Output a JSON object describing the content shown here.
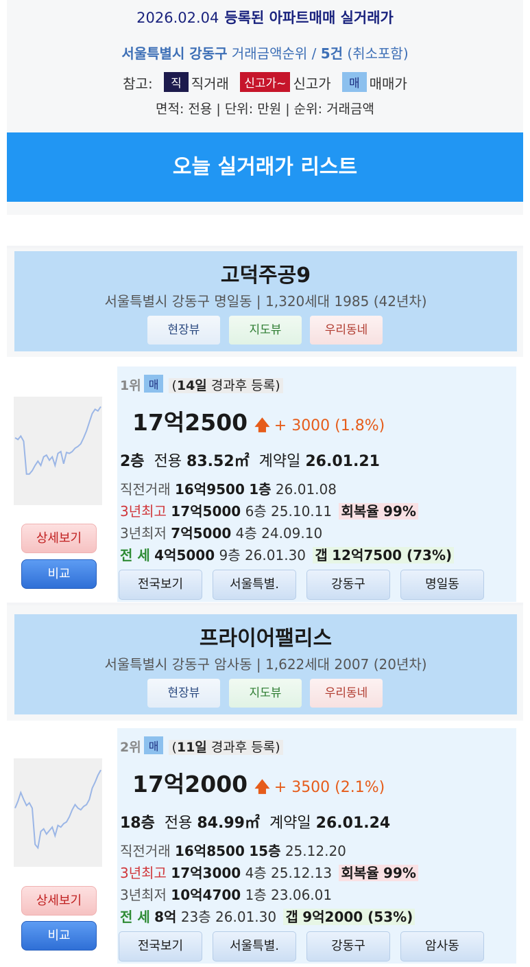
{
  "header": {
    "date": "2026.02.04",
    "title": "등록된 아파트매매 실거래가",
    "region": "서울특별시 강동구",
    "sort": "거래금액순위 /",
    "count": "5건",
    "cancel_note": "(취소포함)",
    "legend_label": "참고:",
    "legend": [
      {
        "badge": "직",
        "text": "직거래"
      },
      {
        "badge": "신고가~",
        "text": "신고가"
      },
      {
        "badge": "매",
        "text": "매매가"
      }
    ],
    "units": "면적: 전용 | 단위: 만원 | 순위: 거래금액"
  },
  "banner": "오늘 실거래가 리스트",
  "common": {
    "view_buttons": [
      "현장뷰",
      "지도뷰",
      "우리동네"
    ],
    "detail_label": "상세보기",
    "compare_label": "비교",
    "prev_label": "직전거래",
    "high_label": "3년최고",
    "low_label": "3년최저",
    "jeonse_label": "전  세",
    "recovery_label": "회복율",
    "gap_label": "갭",
    "area_label": "전용",
    "contract_label": "계약일",
    "up_arrow": "🡅",
    "colors": {
      "banner": "#2196f3",
      "apt_header": "#bcdcf7",
      "panel": "#e9f4fd",
      "price_up": "#e65c1a",
      "high": "#d0363a",
      "jeonse": "#2e8b34"
    }
  },
  "items": [
    {
      "name": "고덕주공9",
      "info": "서울특별시 강동구 명일동 | 1,320세대 1985 (42년차)",
      "rank": "1위",
      "badge": "매",
      "days": "14일",
      "days_suffix": "경과후 등록)",
      "price": "17억2500",
      "change": "+ 3000 (1.8%)",
      "floor": "2층",
      "area": "83.52㎡",
      "contract": "26.01.21",
      "prev": {
        "price": "16억9500",
        "floor": "1층",
        "date": "26.01.08"
      },
      "high": {
        "price": "17억5000",
        "floor": "6층",
        "date": "25.10.11",
        "recovery": "99%"
      },
      "low": {
        "price": "7억5000",
        "floor": "4층",
        "date": "24.09.10"
      },
      "jeonse": {
        "price": "4억5000",
        "floor": "9층",
        "date": "26.01.30",
        "gap": "12억7500 (73%)"
      },
      "region_buttons": [
        "전국보기",
        "서울특별.",
        "강동구",
        "명일동"
      ],
      "spark": [
        0.62,
        0.6,
        0.64,
        0.58,
        0.2,
        0.2,
        0.24,
        0.3,
        0.35,
        0.3,
        0.4,
        0.42,
        0.36,
        0.4,
        0.3,
        0.44,
        0.46,
        0.32,
        0.45,
        0.44,
        0.46,
        0.5,
        0.52,
        0.55,
        0.62,
        0.7,
        0.8,
        0.9,
        0.95,
        0.93,
        0.98
      ]
    },
    {
      "name": "프라이어팰리스",
      "info": "서울특별시 강동구 암사동 | 1,622세대 2007 (20년차)",
      "rank": "2위",
      "badge": "매",
      "days": "11일",
      "days_suffix": "경과후 등록)",
      "price": "17억2000",
      "change": "+ 3500 (2.1%)",
      "floor": "18층",
      "area": "84.99㎡",
      "contract": "26.01.24",
      "prev": {
        "price": "16억8500",
        "floor": "15층",
        "date": "25.12.20"
      },
      "high": {
        "price": "17억3000",
        "floor": "4층",
        "date": "25.12.13",
        "recovery": "99%"
      },
      "low": {
        "price": "10억4700",
        "floor": "1층",
        "date": "23.06.01"
      },
      "jeonse": {
        "price": "8억",
        "floor": "23층",
        "date": "26.01.30",
        "gap": "9억2000 (53%)"
      },
      "region_buttons": [
        "전국보기",
        "서울특별.",
        "강동구",
        "암사동"
      ],
      "spark": [
        0.52,
        0.6,
        0.7,
        0.62,
        0.55,
        0.58,
        0.52,
        0.1,
        0.06,
        0.25,
        0.28,
        0.22,
        0.26,
        0.3,
        0.2,
        0.32,
        0.3,
        0.34,
        0.36,
        0.42,
        0.5,
        0.56,
        0.52,
        0.5,
        0.54,
        0.56,
        0.62,
        0.75,
        0.82,
        0.9,
        0.96
      ]
    }
  ]
}
